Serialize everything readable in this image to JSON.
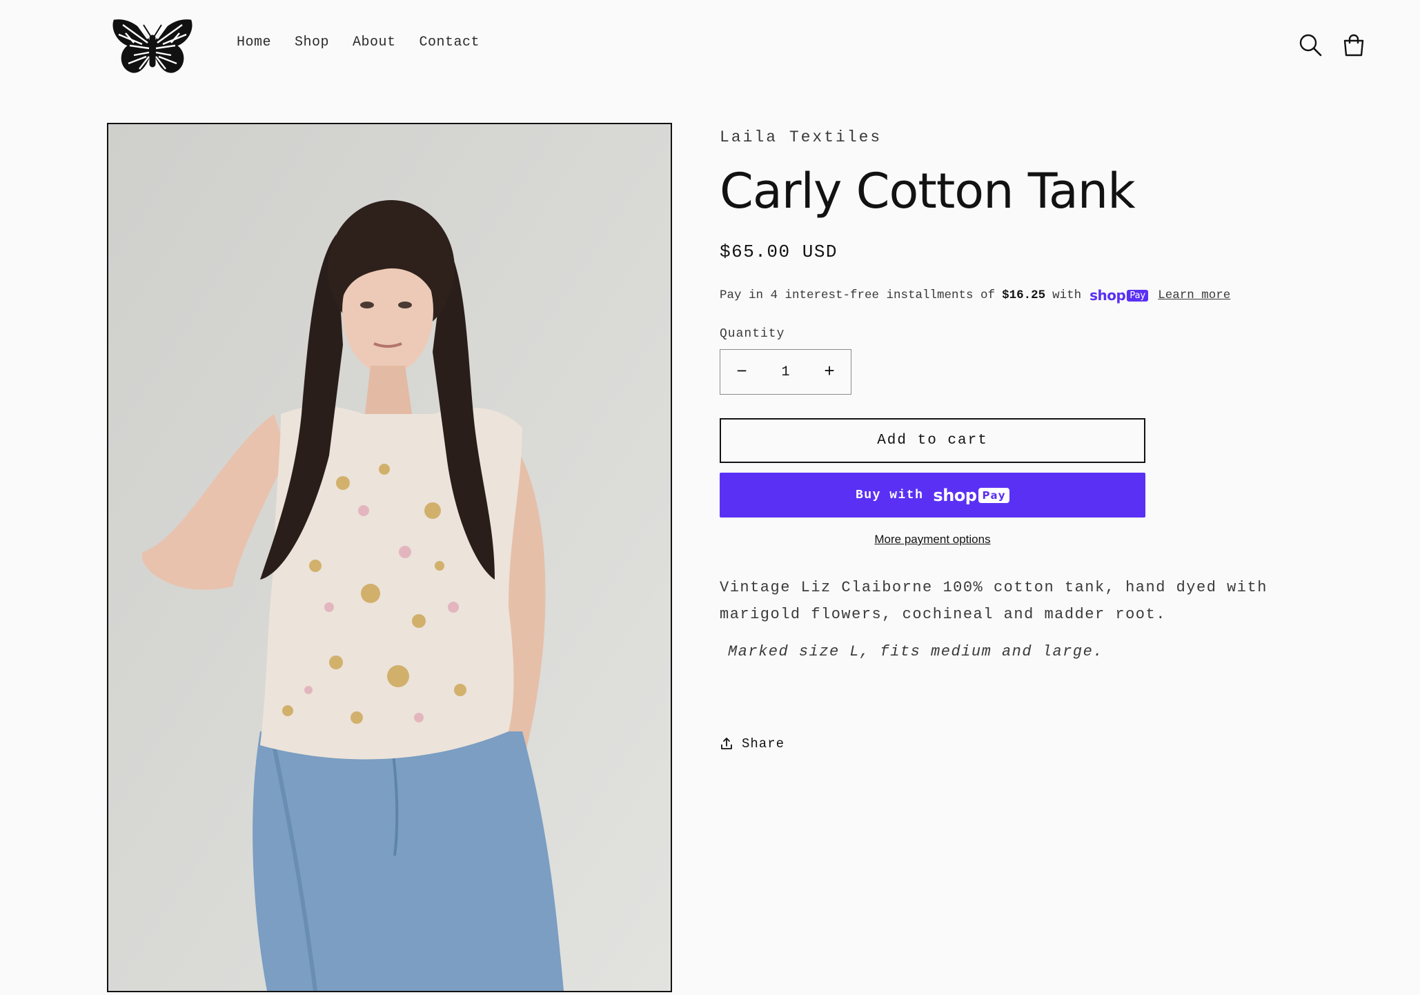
{
  "header": {
    "logo_alt": "butterfly logo",
    "nav": [
      {
        "label": "Home"
      },
      {
        "label": "Shop"
      },
      {
        "label": "About"
      },
      {
        "label": "Contact"
      }
    ],
    "icons": {
      "search": "search-icon",
      "cart": "cart-icon"
    }
  },
  "product": {
    "vendor": "Laila Textiles",
    "title": "Carly Cotton Tank",
    "price": "$65.00 USD",
    "installments": {
      "prefix": "Pay in 4 interest-free installments of",
      "amount": "$16.25",
      "suffix": "with",
      "shop_label": "shop",
      "pay_label": "Pay",
      "learn_more": "Learn more"
    },
    "quantity": {
      "label": "Quantity",
      "value": "1",
      "decrease": "−",
      "increase": "+"
    },
    "add_to_cart": "Add to cart",
    "buy_with": "Buy with",
    "buy_shop_label": "shop",
    "buy_pay_label": "Pay",
    "more_payment_options": "More payment options",
    "description": "Vintage Liz Claiborne 100% cotton tank, hand dyed with marigold flowers, cochineal and madder root.",
    "size_note": "Marked size L, fits medium and large.",
    "share": "Share"
  },
  "colors": {
    "shop_pay": "#5a31f4",
    "background": "#fafafa",
    "text": "#121212"
  }
}
